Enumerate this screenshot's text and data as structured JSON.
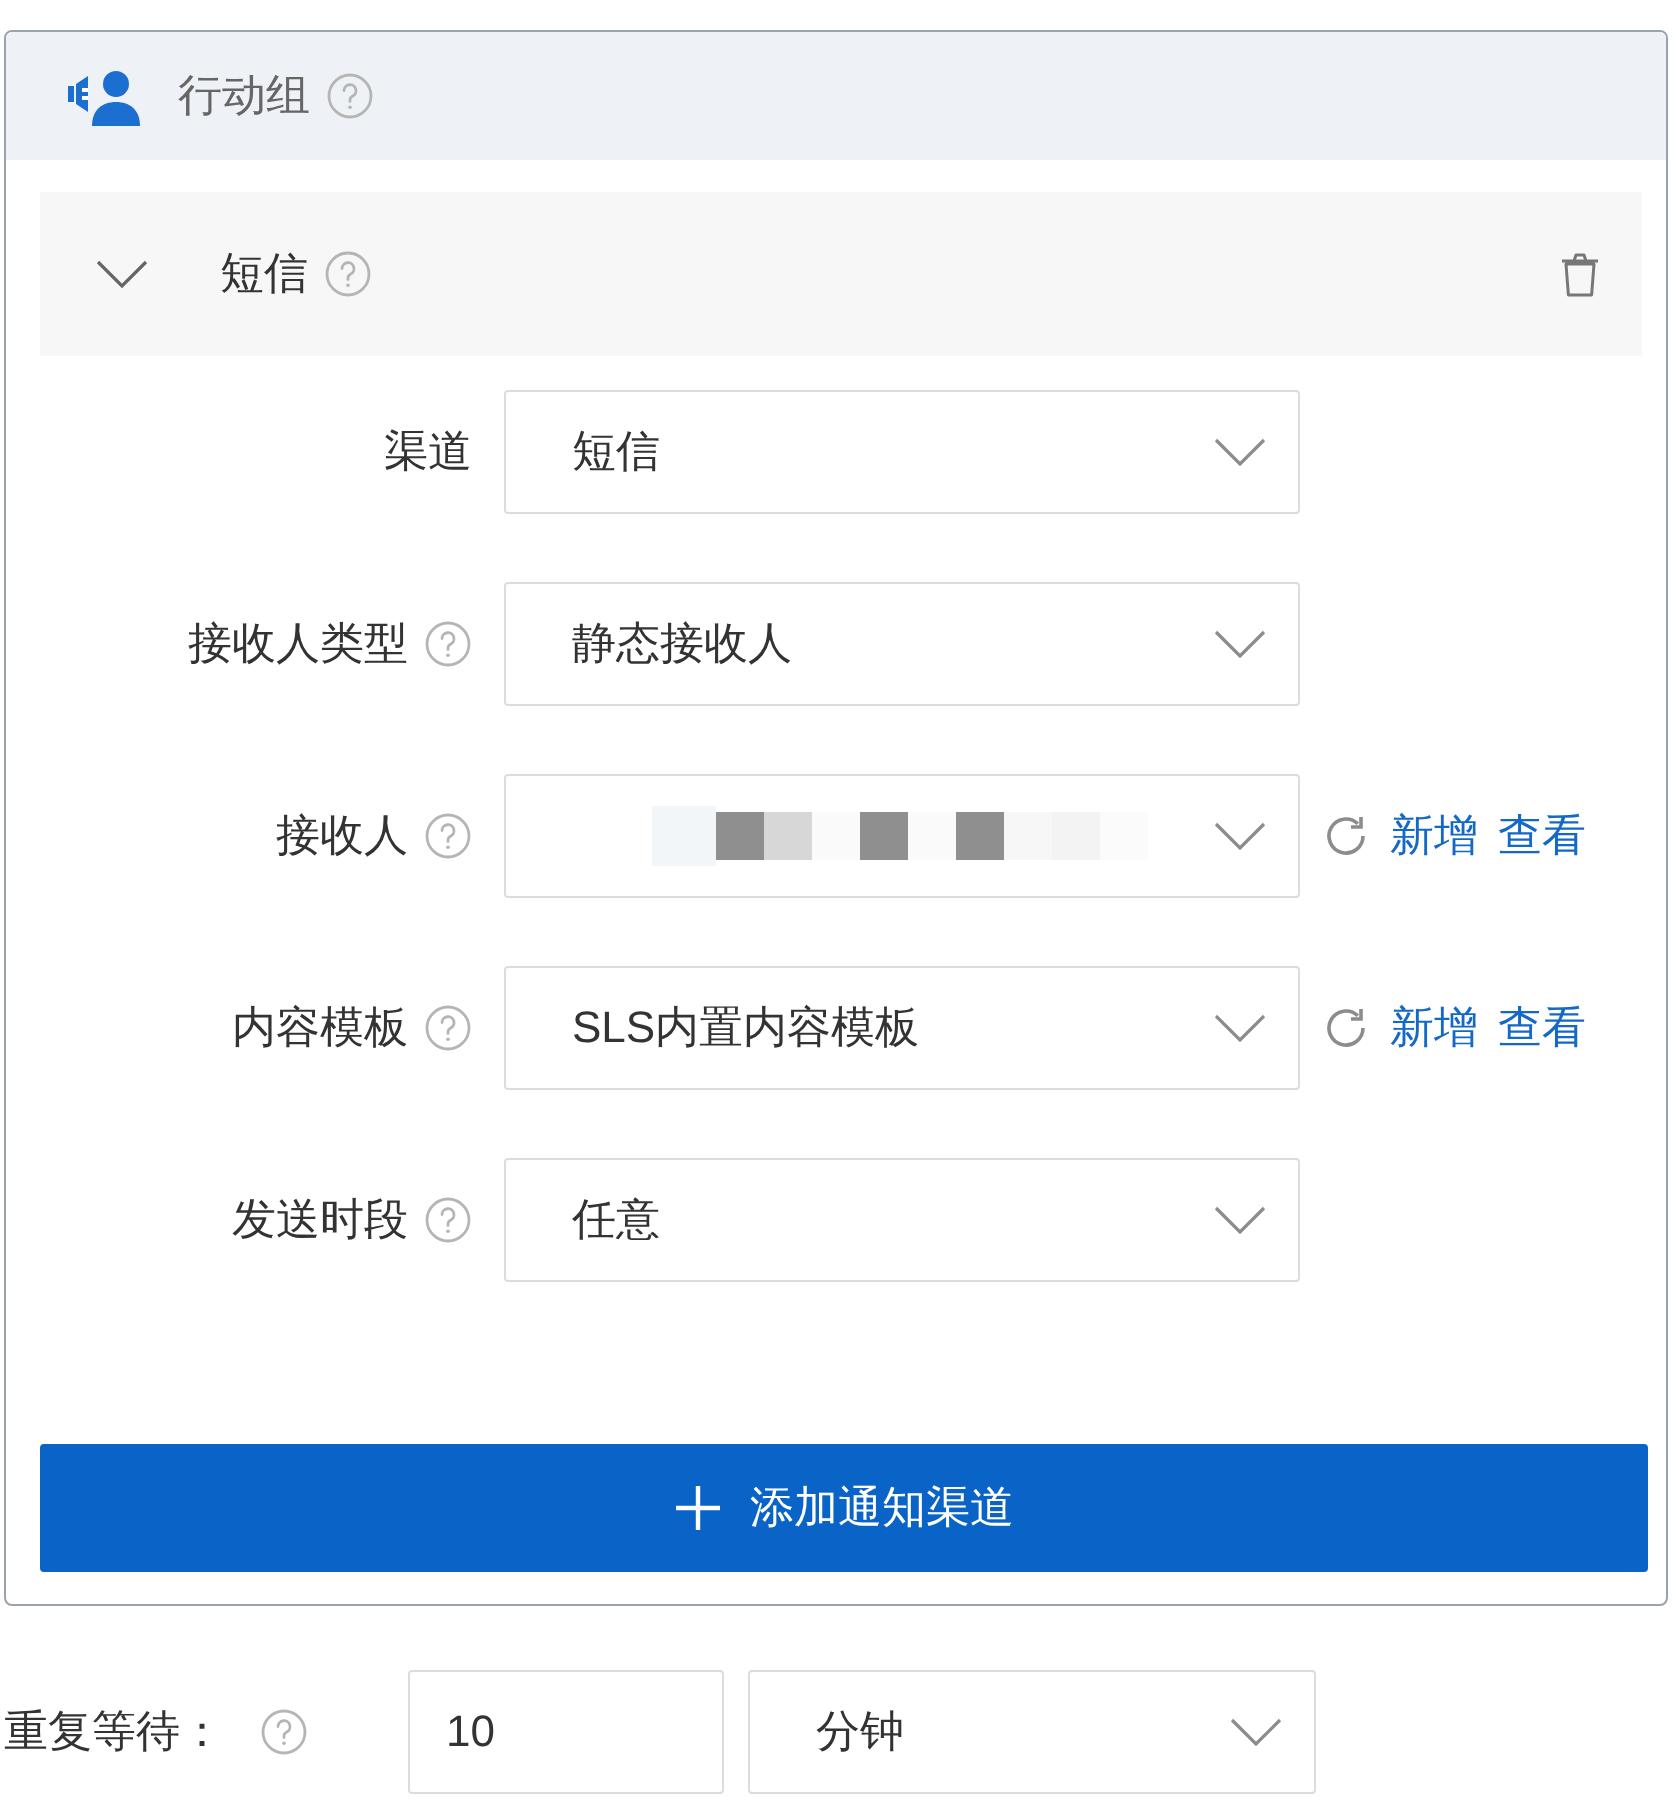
{
  "panel": {
    "title": "行动组",
    "channels": [
      {
        "title": "短信",
        "expanded": true,
        "fields": [
          {
            "label": "渠道",
            "help": false,
            "kind": "select",
            "value": "短信"
          },
          {
            "label": "接收人类型",
            "help": true,
            "kind": "select",
            "value": "静态接收人"
          },
          {
            "label": "接收人",
            "help": true,
            "kind": "masked",
            "links": [
              "新增",
              "查看"
            ]
          },
          {
            "label": "内容模板",
            "help": true,
            "kind": "select",
            "value": "SLS内置内容模板",
            "links": [
              "新增",
              "查看"
            ]
          },
          {
            "label": "发送时段",
            "help": true,
            "kind": "select",
            "value": "任意"
          }
        ]
      }
    ],
    "add_button": {
      "label": "添加通知渠道"
    }
  },
  "repeat_wait": {
    "label": "重复等待：",
    "value": "10",
    "unit": "分钟"
  }
}
